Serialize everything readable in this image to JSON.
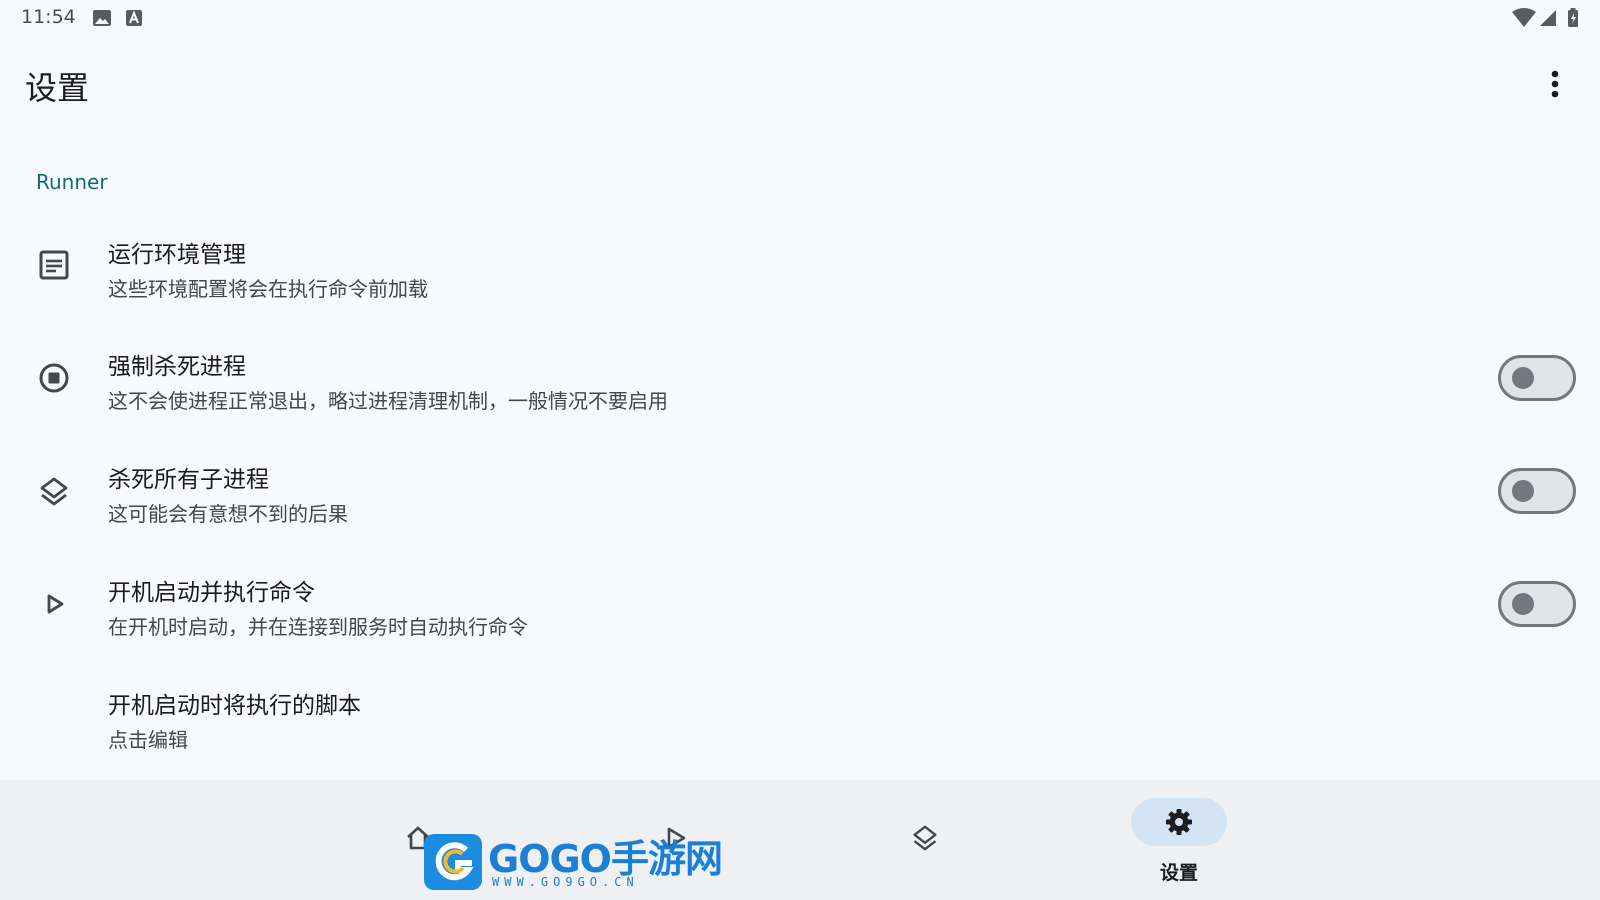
{
  "status_bar": {
    "time": "11:54",
    "left_icons": [
      "image-icon",
      "keyboard-a-icon"
    ],
    "right_icons": [
      "wifi-icon",
      "cell-signal-icon",
      "battery-charging-icon"
    ]
  },
  "app_bar": {
    "title": "设置",
    "menu_icon": "more-vert-icon"
  },
  "section": {
    "header": "Runner"
  },
  "preferences": [
    {
      "title": "运行环境管理",
      "summary": "这些环境配置将会在执行命令前加载",
      "icon": "article-icon",
      "has_switch": false
    },
    {
      "title": "强制杀死进程",
      "summary": "这不会使进程正常退出，略过进程清理机制，一般情况不要启用",
      "icon": "stop-circle-icon",
      "has_switch": true,
      "switch_on": false
    },
    {
      "title": "杀死所有子进程",
      "summary": "这可能会有意想不到的后果",
      "icon": "layers-icon",
      "has_switch": true,
      "switch_on": false
    },
    {
      "title": "开机启动并执行命令",
      "summary": "在开机时启动，并在连接到服务时自动执行命令",
      "icon": "play-arrow-icon",
      "has_switch": true,
      "switch_on": false
    },
    {
      "title": "开机启动时将执行的脚本",
      "summary": "点击编辑",
      "icon": "",
      "has_switch": false
    }
  ],
  "bottom_nav": {
    "items": [
      {
        "name": "home",
        "icon": "home-icon",
        "label": ""
      },
      {
        "name": "run",
        "icon": "play-arrow-icon",
        "label": ""
      },
      {
        "name": "layers",
        "icon": "layers-icon",
        "label": ""
      },
      {
        "name": "settings",
        "icon": "gear-icon",
        "label": "设置",
        "selected": true
      }
    ]
  },
  "watermark": {
    "text": "GOGO手游网",
    "url": "WWW.GO9GO.CN"
  },
  "colors": {
    "background": "#f8f9fb",
    "accent": "#0f6b78",
    "nav_background": "#eef0f4",
    "nav_selected_pill": "#d4e4f4",
    "switch_off": "#74777c"
  }
}
